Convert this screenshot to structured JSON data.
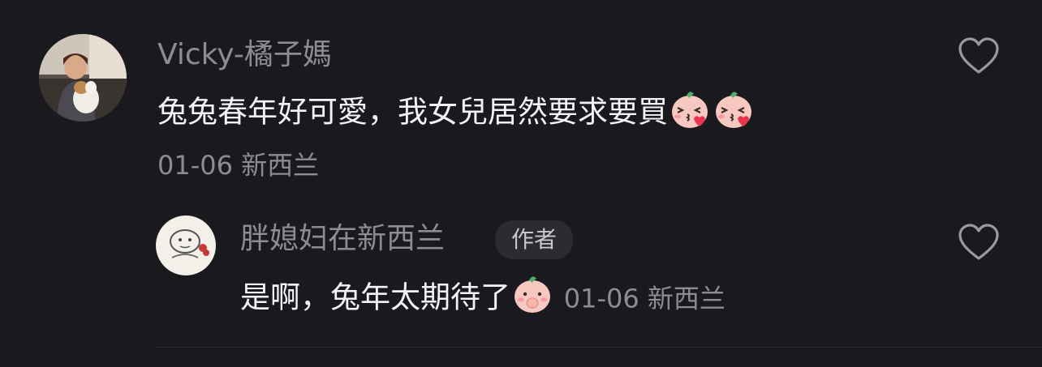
{
  "comments": [
    {
      "author": "Vicky-橘子媽",
      "text": "兔兔春年好可愛，我女兒居然要求要買",
      "reaction_emojis": [
        "peach-kiss-emoji",
        "peach-kiss-emoji"
      ],
      "date": "01-06",
      "location": "新西兰",
      "like_icon": "heart-outline-icon"
    }
  ],
  "replies": [
    {
      "author": "胖媳妇在新西兰",
      "author_badge": "作者",
      "text": "是啊，兔年太期待了",
      "reaction_emojis": [
        "peach-shy-emoji"
      ],
      "date": "01-06",
      "location": "新西兰",
      "like_icon": "heart-outline-icon"
    }
  ],
  "colors": {
    "background": "#1a191e",
    "primary_text": "#f4f4f6",
    "secondary_text": "#8d8c93",
    "badge_bg": "#2c2b31"
  }
}
